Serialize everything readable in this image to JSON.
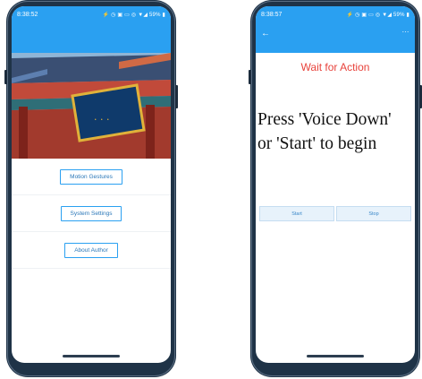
{
  "left_screen": {
    "status": {
      "time": "8:38:52",
      "icons": "⚡ ◷ ▣ ▭ ◎ ▼◢ 59% ▮"
    },
    "menu": [
      {
        "label": "Motion Gestures"
      },
      {
        "label": "System Settings"
      },
      {
        "label": "About Author"
      }
    ]
  },
  "right_screen": {
    "status": {
      "time": "8:38:57",
      "icons": "⚡ ◷ ▣ ▭ ◎ ▼◢ 59% ▮"
    },
    "appbar": {
      "back_icon": "back-arrow-icon",
      "more_icon": "more-icon"
    },
    "wait_label": "Wait for Action",
    "prompt_line1": "Press  'Voice Down'",
    "prompt_line2": "or 'Start' to begin",
    "start_label": "Start",
    "stop_label": "Stop"
  },
  "colors": {
    "accent": "#2aa0f1",
    "wait_text": "#e8433c",
    "frame": "#1f3347"
  }
}
